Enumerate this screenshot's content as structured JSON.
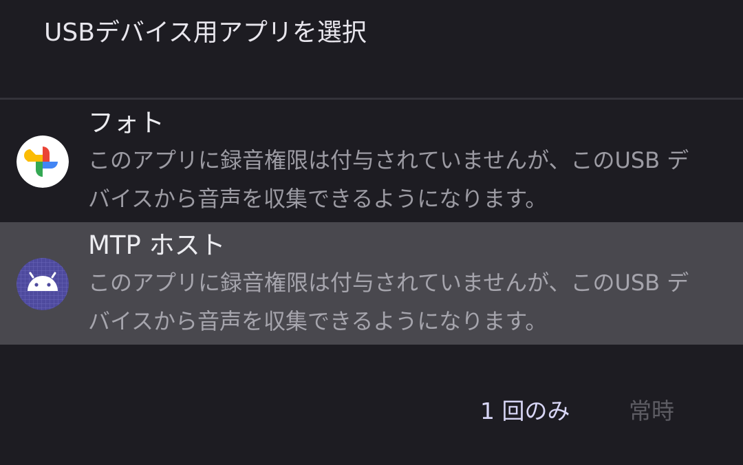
{
  "dialog": {
    "title": "USBデバイス用アプリを選択"
  },
  "apps": [
    {
      "name": "フォト",
      "description": "このアプリに録音権限は付与されていませんが、このUSB デバイスから音声を収集できるようになります。",
      "icon": "google-photos-icon",
      "selected": false
    },
    {
      "name": "MTP ホスト",
      "description": "このアプリに録音権限は付与されていませんが、このUSB デバイスから音声を収集できるようになります。",
      "icon": "android-icon",
      "selected": true
    }
  ],
  "actions": {
    "just_once_label": "1 回のみ",
    "always_label": "常時"
  },
  "colors": {
    "background": "#1d1c22",
    "selected_row": "#49484e",
    "accent": "#d8d6f6",
    "disabled": "#5d5c63"
  }
}
